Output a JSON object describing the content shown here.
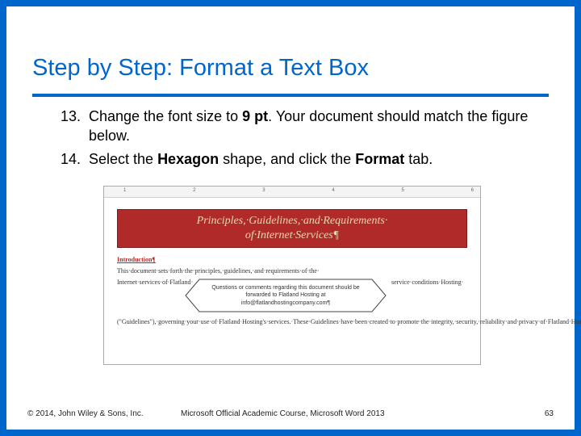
{
  "title": "Step by Step: Format a Text Box",
  "steps": [
    {
      "num": "13.",
      "before": "Change the font size to ",
      "bold1": "9 pt",
      "mid": ". Your document should match the figure below.",
      "bold2": "",
      "after": ""
    },
    {
      "num": "14.",
      "before": "Select the ",
      "bold1": "Hexagon",
      "mid": " shape, and click the ",
      "bold2": "Format",
      "after": " tab."
    }
  ],
  "figure": {
    "ruler": [
      "1",
      "",
      "2",
      "",
      "3",
      "",
      "4",
      "",
      "5",
      "",
      "6"
    ],
    "banner_line1": "Principles,·Guidelines,·and·Requirements·",
    "banner_line2": "of·Internet·Services¶",
    "intro_label": "Introduction¶",
    "intro_para": "This·document·sets·forth·the·principles,·guidelines,·and·requirements·of·the·",
    "col_left": "Internet·services·of·Flatland·",
    "hex_text": "Questions or comments regarding this document should be forwarded to Flatland Hosting at info@flatlandhostingcompany.com¶",
    "col_right": "service·conditions·Hosting·",
    "para2": "(\"Guidelines\"),·governing·your·use·of·Flatland·Hosting's·services.·These·Guidelines·have·been·created·to·promote·the·integrity,·security,·reliability·and·privacy·of·Flatland·Hosting's·facilities,·network,·and·your·data·contained·within.·Flatland·Hosting·retains·the·right·to·modify·these·Guidelines·at·any·time·and·any·such·modification·shall·be·automatically·effective·as·to·all·customers·when·"
  },
  "footer": {
    "copyright": "© 2014, John Wiley & Sons, Inc.",
    "course": "Microsoft Official Academic Course, Microsoft Word 2013",
    "page": "63"
  }
}
